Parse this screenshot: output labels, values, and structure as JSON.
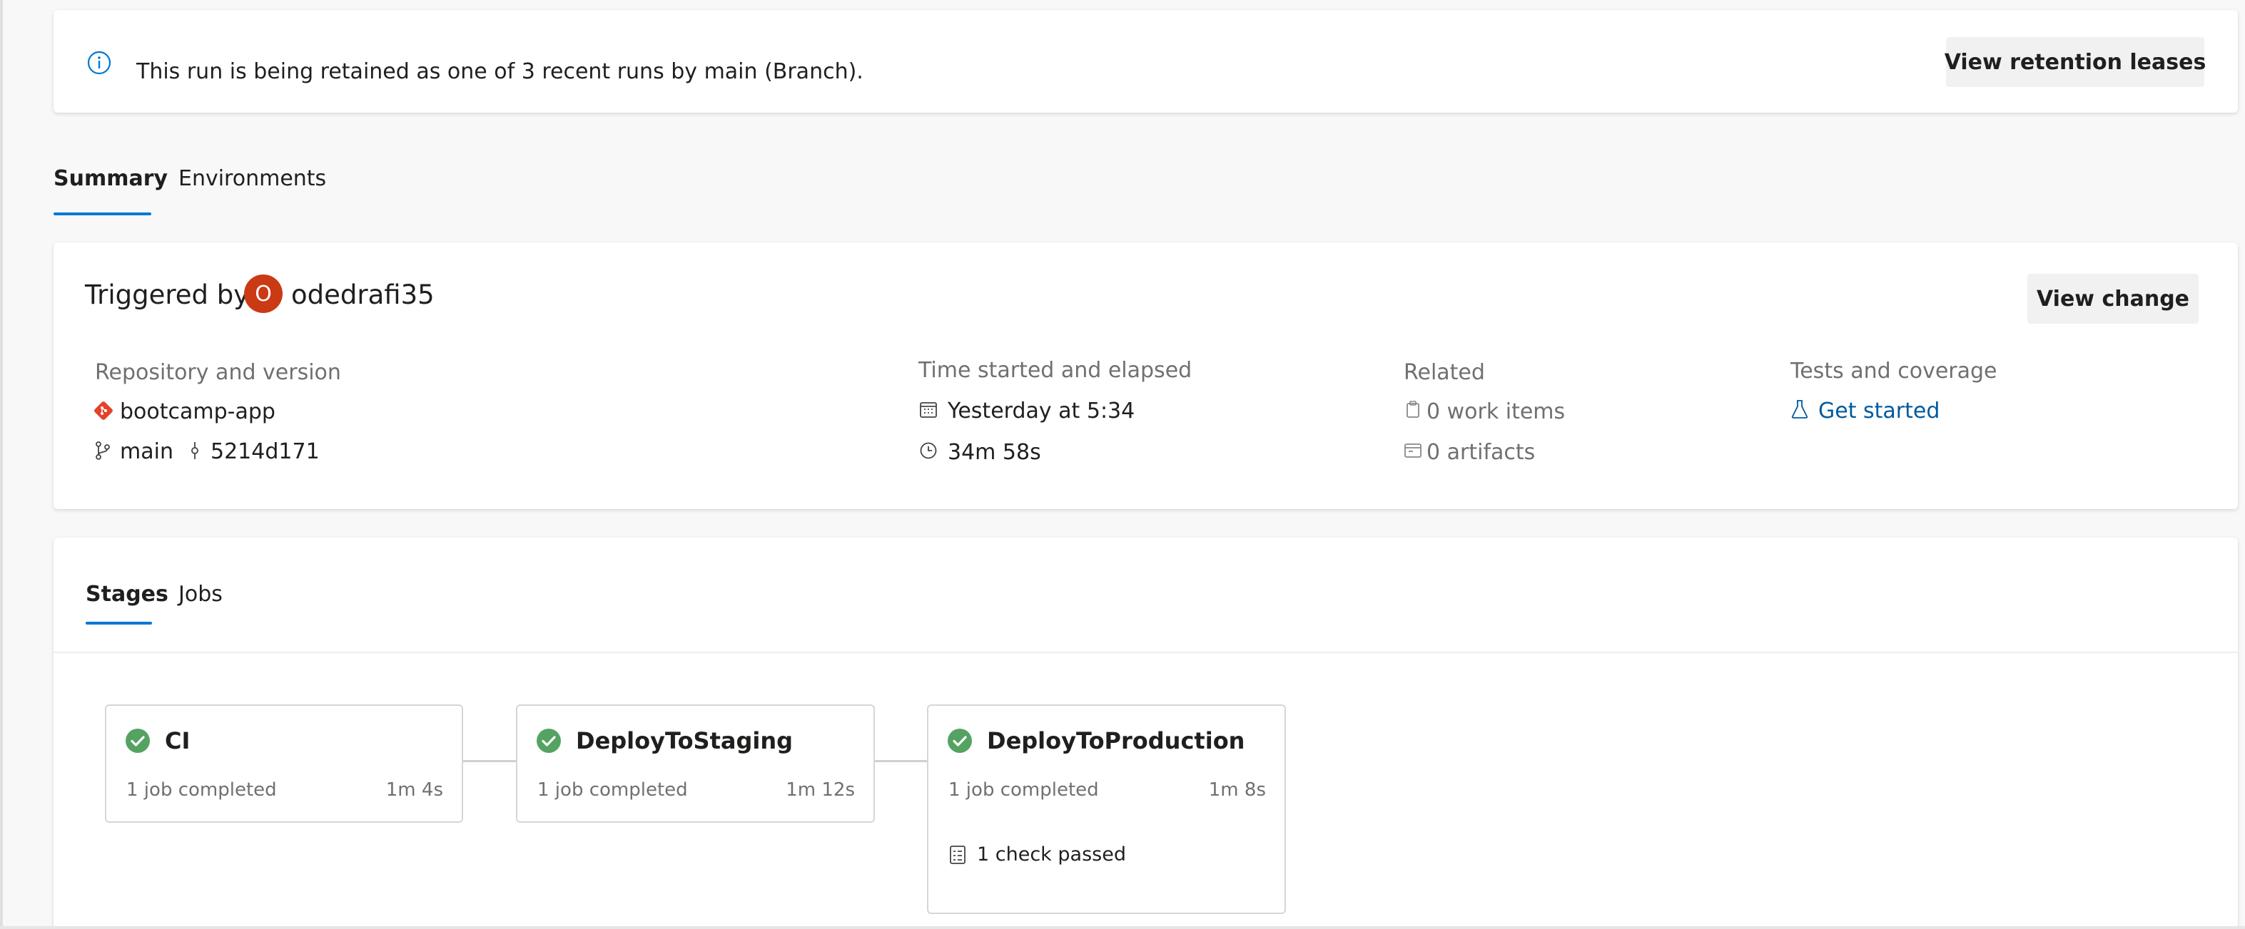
{
  "banner": {
    "icon": "info-icon",
    "message": "This run is being retained as one of 3 recent runs by main (Branch).",
    "button_label": "View retention leases"
  },
  "tabs": [
    {
      "label": "Summary",
      "selected": true
    },
    {
      "label": "Environments",
      "selected": false
    }
  ],
  "summary": {
    "triggered_label": "Triggered by",
    "avatar_initial": "O",
    "avatar_color": "#ca3a14",
    "user": "odedrafi35",
    "view_change_label": "View change",
    "repository": {
      "heading": "Repository and version",
      "repo_name": "bootcamp-app",
      "branch": "main",
      "commit": "5214d171"
    },
    "time": {
      "heading": "Time started and elapsed",
      "started": "Yesterday at 5:34",
      "elapsed": "34m 58s"
    },
    "related": {
      "heading": "Related",
      "work_items": "0 work items",
      "artifacts": "0 artifacts"
    },
    "tests": {
      "heading": "Tests and coverage",
      "link": "Get started"
    }
  },
  "stages_tabs": [
    {
      "label": "Stages",
      "selected": true
    },
    {
      "label": "Jobs",
      "selected": false
    }
  ],
  "stages": [
    {
      "name": "CI",
      "jobs": "1 job completed",
      "duration": "1m 4s",
      "status": "succeeded"
    },
    {
      "name": "DeployToStaging",
      "jobs": "1 job completed",
      "duration": "1m 12s",
      "status": "succeeded"
    },
    {
      "name": "DeployToProduction",
      "jobs": "1 job completed",
      "duration": "1m 8s",
      "status": "succeeded",
      "checks": "1 check passed"
    }
  ],
  "colors": {
    "accent": "#0078d4",
    "success": "#55a362",
    "link": "#005a9e",
    "git_icon": "#e24329"
  }
}
